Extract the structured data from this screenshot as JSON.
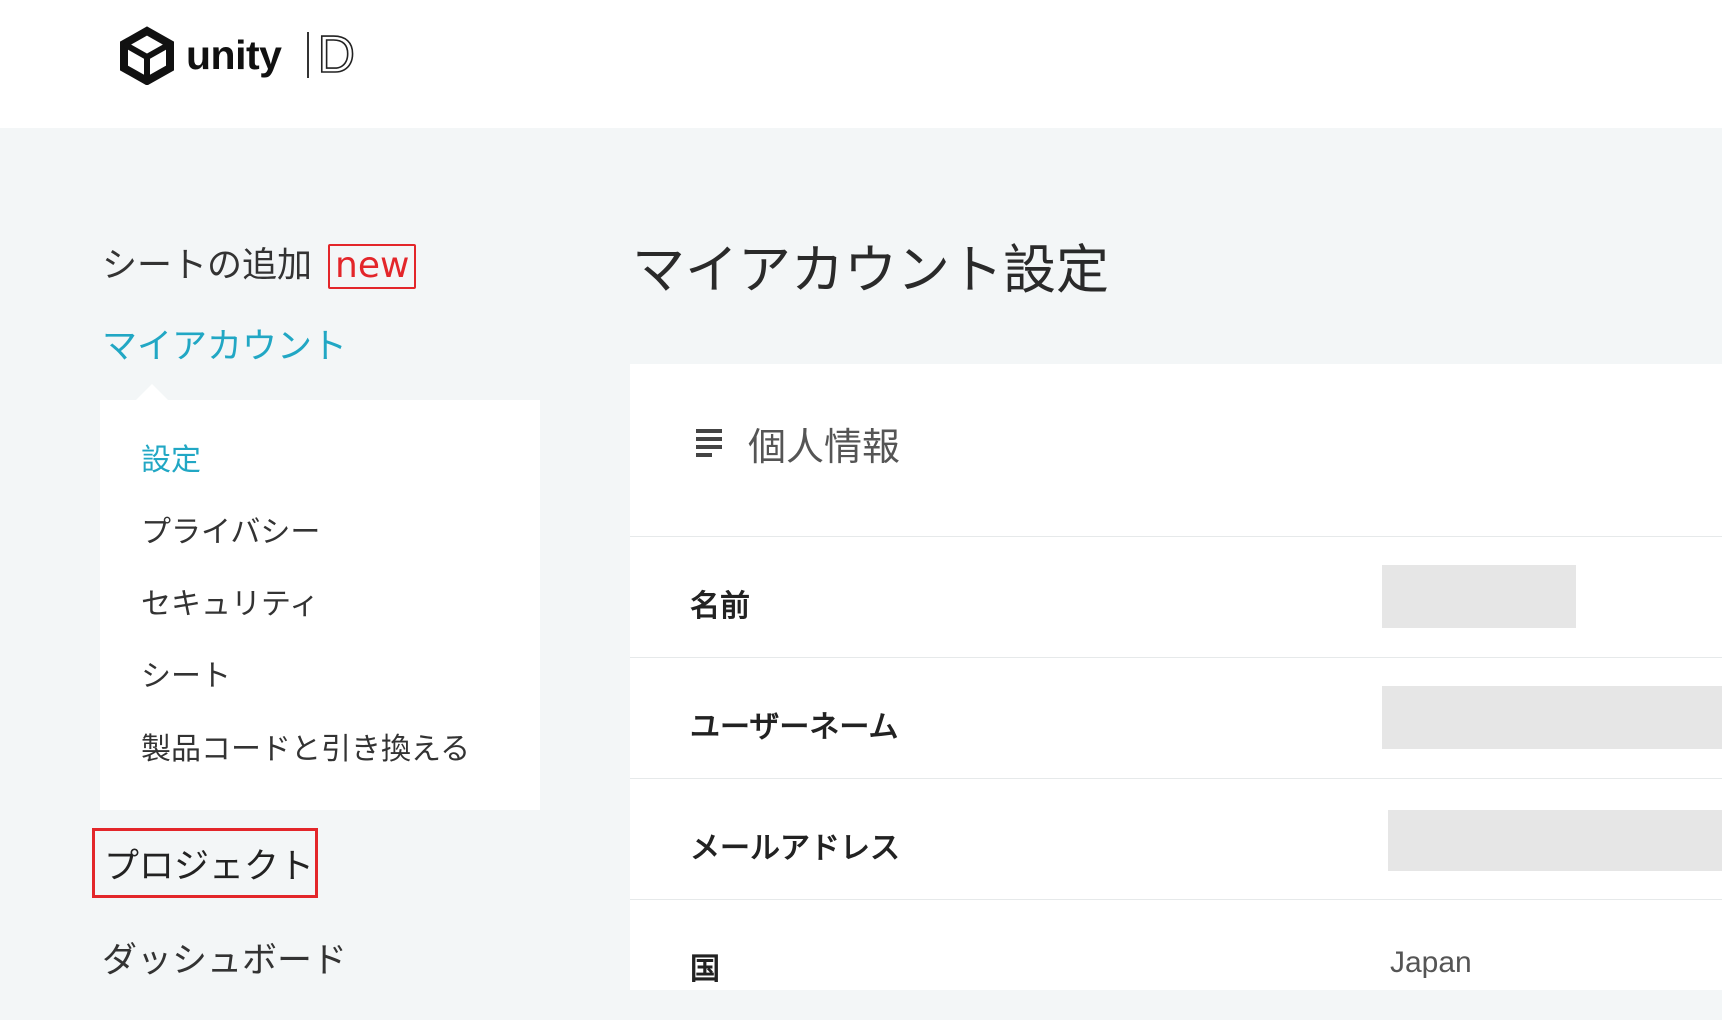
{
  "header": {
    "logo_text": "unity",
    "logo_suffix": "D"
  },
  "sidebar": {
    "add_seat": "シートの追加",
    "new_badge": "new",
    "my_account": "マイアカウント",
    "submenu": [
      {
        "label": "設定",
        "active": true
      },
      {
        "label": "プライバシー",
        "active": false
      },
      {
        "label": "セキュリティ",
        "active": false
      },
      {
        "label": "シート",
        "active": false
      },
      {
        "label": "製品コードと引き換える",
        "active": false
      }
    ],
    "projects": "プロジェクト",
    "dashboard": "ダッシュボード"
  },
  "main": {
    "title": "マイアカウント設定",
    "section_title": "個人情報",
    "fields": [
      {
        "label": "名前",
        "value": ""
      },
      {
        "label": "ユーザーネーム",
        "value": ""
      },
      {
        "label": "メールアドレス",
        "value": ""
      },
      {
        "label": "国",
        "value": "Japan"
      }
    ]
  },
  "colors": {
    "accent": "#21a7c4",
    "highlight_red": "#e3262a",
    "page_bg": "#f3f6f7"
  }
}
